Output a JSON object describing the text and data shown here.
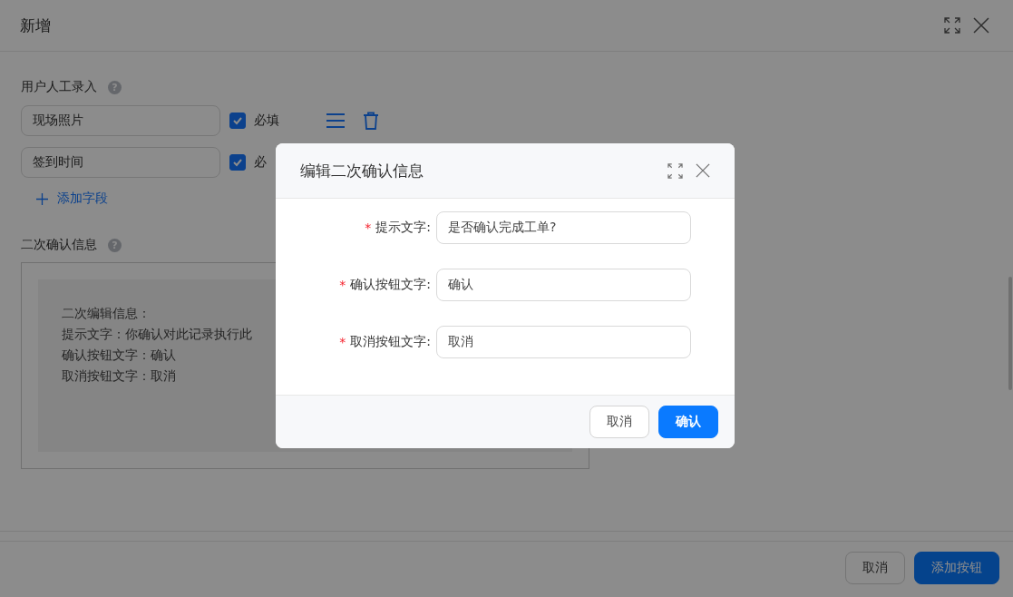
{
  "main_window": {
    "title": "新增"
  },
  "manual_entry": {
    "label": "用户人工录入",
    "help_mark": "?",
    "fields": [
      {
        "value": "现场照片",
        "required_label": "必填",
        "checked": true
      },
      {
        "value": "签到时间",
        "required_label": "必",
        "checked": true
      }
    ],
    "add_field": "添加字段"
  },
  "confirm_info": {
    "label": "二次确认信息",
    "help_mark": "?",
    "preview_lines": [
      "二次编辑信息：",
      "提示文字：你确认对此记录执行此",
      "确认按钮文字：确认",
      "取消按钮文字：取消"
    ]
  },
  "footer_buttons": [
    {
      "label": "取消",
      "kind": "default"
    },
    {
      "label": "添加按钮",
      "kind": "primary"
    }
  ],
  "dialog": {
    "title": "编辑二次确认信息",
    "fields": [
      {
        "label": "提示文字:",
        "required": true,
        "required_mark": "*",
        "value": "是否确认完成工单?"
      },
      {
        "label": "确认按钮文字:",
        "required": true,
        "required_mark": "*",
        "value": "确认"
      },
      {
        "label": "取消按钮文字:",
        "required": true,
        "required_mark": "*",
        "value": "取消"
      }
    ],
    "buttons": [
      {
        "label": "取消",
        "kind": "default"
      },
      {
        "label": "确认",
        "kind": "primary"
      }
    ]
  }
}
